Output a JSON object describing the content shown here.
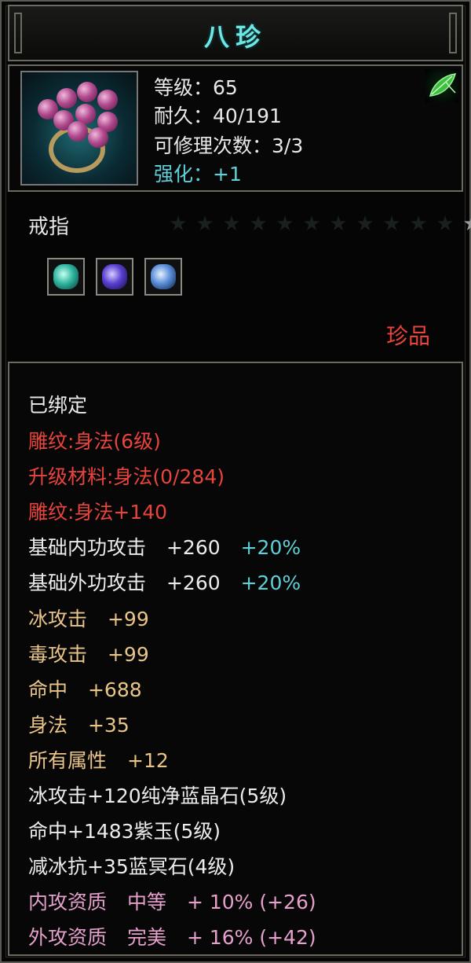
{
  "item": {
    "name": "八珍",
    "stats": {
      "level": "等级：65",
      "durability": "耐久：40/191",
      "repair": "可修理次数：3/3",
      "enhance": "强化：+1"
    },
    "type": "戒指",
    "stars": {
      "lit": 1,
      "total": 12
    },
    "quality": "珍品",
    "icons": {
      "portrait": "ring-icon",
      "badge": "leaf-icon",
      "star": "star-icon",
      "sockets": [
        "teal-gem-icon",
        "purple-gem-icon",
        "blue-gem-icon"
      ]
    },
    "colors": {
      "title": "#6fe6e6",
      "red": "#e8443c",
      "gold": "#e9c489",
      "pink": "#e6a0cc",
      "cyan": "#5fd0d8",
      "white": "#ececec"
    }
  },
  "attributes": {
    "bound": "已绑定",
    "engrave1": "雕纹:身法(6级)",
    "upgrade_material": "升级材料:身法(0/284)",
    "engrave2": "雕纹:身法+140",
    "base_inner": {
      "label": "基础内功攻击",
      "value": "+260",
      "bonus": "+20%"
    },
    "base_outer": {
      "label": "基础外功攻击",
      "value": "+260",
      "bonus": "+20%"
    },
    "ice_attack": {
      "label": "冰攻击",
      "value": "+99"
    },
    "poison_attack": {
      "label": "毒攻击",
      "value": "+99"
    },
    "hit": {
      "label": "命中",
      "value": "+688"
    },
    "agility": {
      "label": "身法",
      "value": "+35"
    },
    "all_attr": {
      "label": "所有属性",
      "value": "+12"
    },
    "gem1": "冰攻击+120纯净蓝晶石(5级)",
    "gem2": "命中+1483紫玉(5级)",
    "gem3": "减冰抗+35蓝冥石(4级)",
    "inner_aptitude": {
      "label": "内攻资质",
      "grade": "中等",
      "value": "+ 10% (+26)"
    },
    "outer_aptitude": {
      "label": "外攻资质",
      "grade": "完美",
      "value": "+ 16% (+42)"
    }
  }
}
